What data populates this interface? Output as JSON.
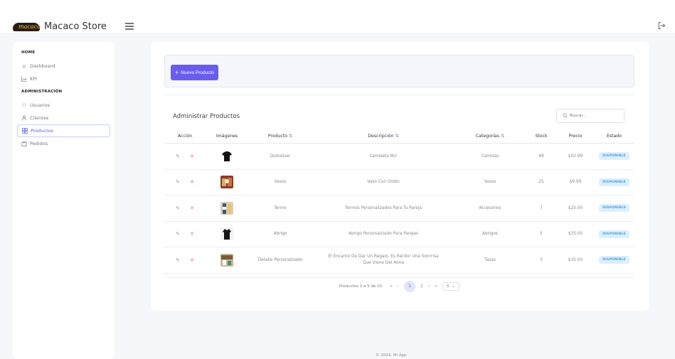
{
  "header": {
    "brand_logo_text": "macaco",
    "brand_name": "Macaco Store"
  },
  "sidebar": {
    "sections": [
      {
        "title": "HOME",
        "items": [
          {
            "label": "Dashboard",
            "icon": "home-icon"
          },
          {
            "label": "KPI",
            "icon": "chart-icon"
          }
        ]
      },
      {
        "title": "ADMINISTRACIÓN",
        "items": [
          {
            "label": "Usuarios",
            "icon": "users-icon"
          },
          {
            "label": "Clientes",
            "icon": "user-icon"
          },
          {
            "label": "Productos",
            "icon": "grid-icon",
            "active": true
          },
          {
            "label": "Pedidos",
            "icon": "bag-icon"
          }
        ]
      }
    ]
  },
  "toolbar": {
    "new_label": "Nuevo Producto"
  },
  "table": {
    "title": "Administrar Productos",
    "search_placeholder": "Buscar...",
    "columns": [
      "Acción",
      "Imágenes",
      "Producto",
      "Descripción",
      "Categorías",
      "Stock",
      "Precio",
      "Estado"
    ],
    "rows": [
      {
        "producto": "Quiksilver",
        "descripcion": "Camiseta M/c",
        "categoria": "Camisas",
        "stock": "48",
        "precio": "$50.99",
        "estado": "DISPONIBLE",
        "img": "tshirt"
      },
      {
        "producto": "Vasos",
        "descripcion": "Vaso Con Globo",
        "categoria": "Vasos",
        "stock": "25",
        "precio": "$9.99",
        "estado": "DISPONIBLE",
        "img": "vasos"
      },
      {
        "producto": "Termo",
        "descripcion": "Termos Personalizados Para Tu Pareja",
        "categoria": "Accesorios",
        "stock": "7",
        "precio": "$25.00",
        "estado": "DISPONIBLE",
        "img": "termo"
      },
      {
        "producto": "Abrigo",
        "descripcion": "Abrigo Perzonalizado Para Parejas",
        "categoria": "Abrigos",
        "stock": "5",
        "precio": "$35.00",
        "estado": "DISPONIBLE",
        "img": "abrigo"
      },
      {
        "producto": "Detalle Personalizado",
        "descripcion": "El Encanto De Dar Un Regalo, Es Recibir Una Sonrrisa Que Viene Del Alma",
        "categoria": "Tazas",
        "stock": "3",
        "precio": "$35.00",
        "estado": "DISPONIBLE",
        "img": "detalle"
      }
    ]
  },
  "pager": {
    "info": "Productos 1 a 5 de 10",
    "first": "«",
    "prev": "‹",
    "pages": [
      "1",
      "2"
    ],
    "next": "›",
    "last": "»",
    "rows_per_page": "5"
  },
  "footer": {
    "text": "© 2024, Mi App"
  },
  "colors": {
    "accent": "#6b5cf0",
    "badge_bg": "#dcefff",
    "badge_text": "#4a9fd6",
    "delete": "#e57373"
  }
}
